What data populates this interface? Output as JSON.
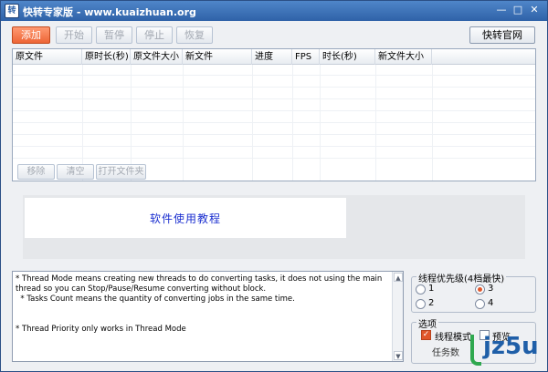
{
  "window": {
    "title": "快转专家版 - www.kuaizhuan.org",
    "icon_label": "转",
    "controls": {
      "minimize": "—",
      "maximize": "□",
      "close": "✕"
    }
  },
  "toolbar": {
    "add": "添加",
    "start": "开始",
    "pause": "暂停",
    "stop": "停止",
    "resume": "恢复",
    "website": "快转官网"
  },
  "table": {
    "columns": [
      "原文件",
      "原时长(秒)",
      "原文件大小",
      "新文件",
      "进度",
      "FPS",
      "时长(秒)",
      "新文件大小"
    ],
    "rows": []
  },
  "list_buttons": {
    "remove": "移除",
    "clear": "清空",
    "open_folder": "打开文件夹"
  },
  "preview": {
    "banner_text": "软件使用教程"
  },
  "log": {
    "text": "* Thread Mode means creating new threads to do converting tasks, it does not using the main thread so you can Stop/Pause/Resume converting without block.\n  * Tasks Count means the quantity of converting jobs in the same time.\n\n\n* Thread Priority only works in Thread Mode"
  },
  "priority": {
    "title": "线程优先级(4档最快)",
    "options": [
      "1",
      "3",
      "2",
      "4"
    ],
    "selected": "3"
  },
  "options": {
    "title": "选项",
    "thread_mode": "线程模式",
    "thread_mode_checked": true,
    "preview": "预览",
    "preview_checked": false,
    "tasks_label": "任务数"
  },
  "watermark": {
    "text": "jz5u"
  },
  "colors": {
    "title_bar": "#2f62a8",
    "accent": "#ee6536",
    "banner_text": "#1b2fd0"
  }
}
